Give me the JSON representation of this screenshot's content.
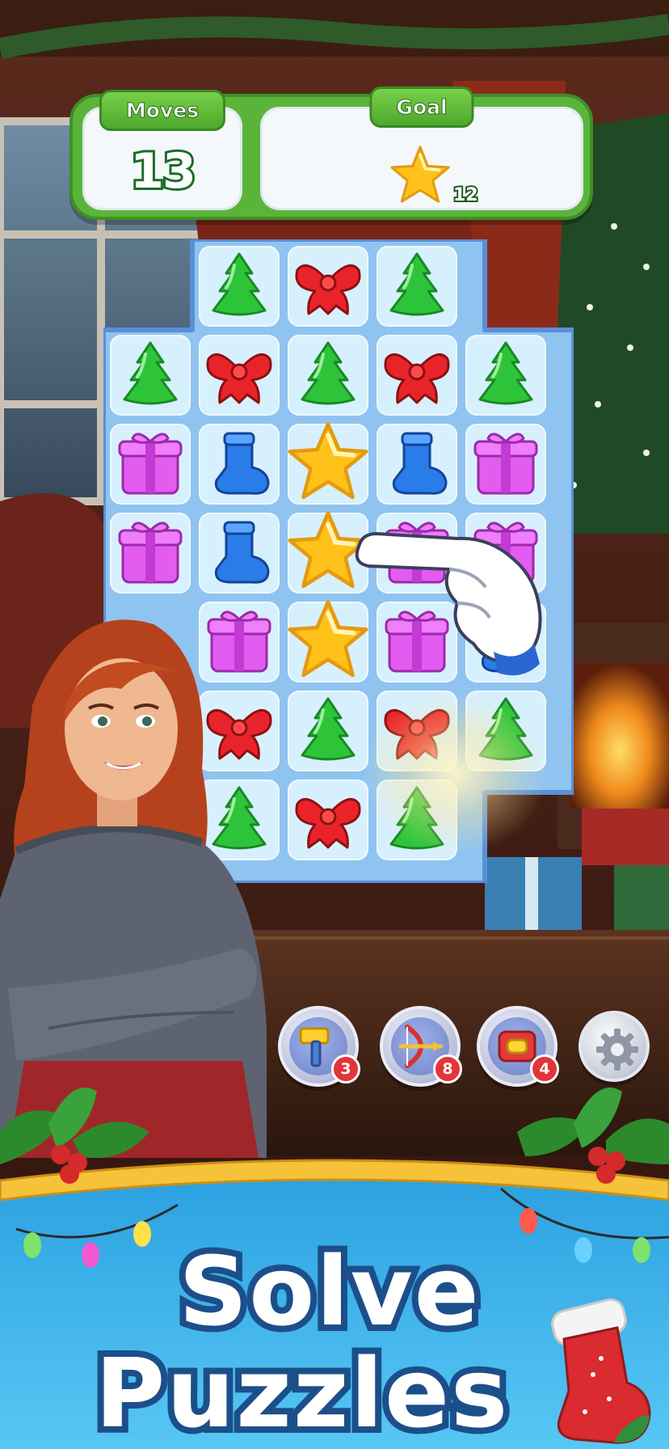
{
  "hud": {
    "moves_label": "Moves",
    "moves_value": "13",
    "goal_label": "Goal",
    "goal_icon": "star",
    "goal_count": "12"
  },
  "board": {
    "rows": [
      [
        "empty",
        "tree",
        "bow",
        "tree",
        "empty"
      ],
      [
        "tree",
        "bow",
        "tree",
        "bow",
        "tree"
      ],
      [
        "gift",
        "sock",
        "star",
        "sock",
        "gift"
      ],
      [
        "gift",
        "sock",
        "star",
        "gift",
        "gift"
      ],
      [
        "empty",
        "gift",
        "star",
        "gift",
        "sock"
      ],
      [
        "empty",
        "bow",
        "tree",
        "bow",
        "tree"
      ],
      [
        "empty",
        "tree",
        "bow",
        "tree",
        "empty"
      ]
    ],
    "hint": "pointing-hand"
  },
  "boosters": [
    {
      "name": "hammer",
      "count": "3"
    },
    {
      "name": "crossbow",
      "count": "8"
    },
    {
      "name": "magnet",
      "count": "4"
    }
  ],
  "settings_icon": "gear-icon",
  "headline": {
    "line1": "Solve",
    "line2": "Puzzles"
  },
  "colors": {
    "hud_green": "#5bb43a",
    "tile_bg": "#d7f0fd",
    "banner_blue": "#2ea7e3",
    "headline_outline": "#1c4f8a",
    "badge_red": "#e2353a"
  }
}
